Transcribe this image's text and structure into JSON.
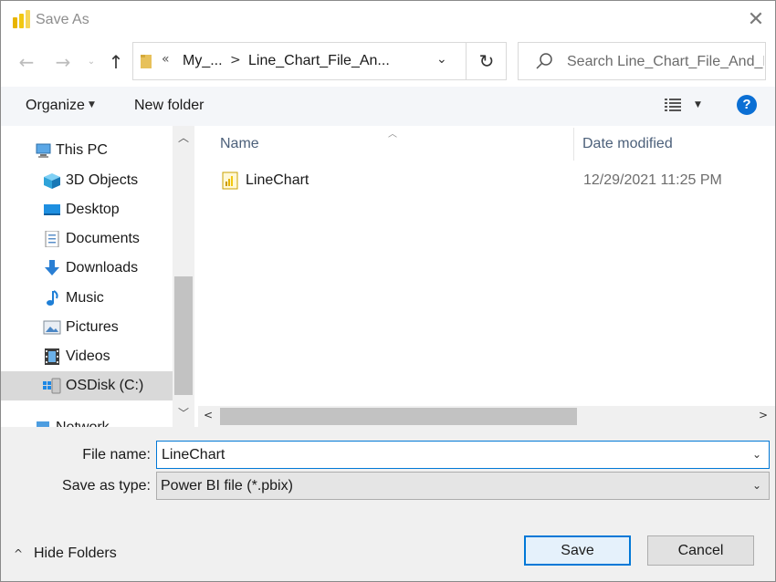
{
  "window": {
    "title": "Save As",
    "close_glyph": "✕"
  },
  "nav": {
    "back_glyph": "←",
    "forward_glyph": "→",
    "recent_glyph": "⌄",
    "up_glyph": "↑"
  },
  "address": {
    "overflow_glyph": "«",
    "segments": [
      "My_...",
      "Line_Chart_File_An..."
    ],
    "separator_glyph": ">",
    "dropdown_glyph": "⌄",
    "refresh_glyph": "↻"
  },
  "search": {
    "placeholder": "Search Line_Chart_File_And_E..."
  },
  "toolbar": {
    "organize_label": "Organize",
    "caret_glyph": "▼",
    "new_folder_label": "New folder",
    "help_label": "?"
  },
  "sidebar": {
    "items": [
      {
        "label": "This PC",
        "icon": "computer-icon"
      },
      {
        "label": "3D Objects",
        "icon": "cube-icon"
      },
      {
        "label": "Desktop",
        "icon": "desktop-icon"
      },
      {
        "label": "Documents",
        "icon": "document-icon"
      },
      {
        "label": "Downloads",
        "icon": "download-arrow-icon"
      },
      {
        "label": "Music",
        "icon": "music-note-icon"
      },
      {
        "label": "Pictures",
        "icon": "picture-icon"
      },
      {
        "label": "Videos",
        "icon": "film-icon"
      },
      {
        "label": "OSDisk (C:)",
        "icon": "drive-icon",
        "selected": true
      },
      {
        "label": "Network",
        "icon": "network-icon"
      }
    ],
    "scroll_up_glyph": "︿",
    "scroll_down_glyph": "﹀"
  },
  "filelist": {
    "columns": {
      "name": "Name",
      "date": "Date modified",
      "sort_glyph": "︿"
    },
    "rows": [
      {
        "name": "LineChart",
        "date": "12/29/2021 11:25 PM",
        "icon": "pbix-file-icon"
      }
    ],
    "scroll_left_glyph": "<",
    "scroll_right_glyph": ">"
  },
  "form": {
    "file_name_label": "File name:",
    "file_name_value": "LineChart",
    "save_type_label": "Save as type:",
    "save_type_value": "Power BI file (*.pbix)",
    "dropdown_glyph": "⌄"
  },
  "footer": {
    "hide_folders_glyph": "^",
    "hide_folders_label": "Hide Folders",
    "save_label": "Save",
    "cancel_label": "Cancel"
  },
  "colors": {
    "accent": "#0078d7",
    "powerbi_yellow": "#f2c811",
    "help_blue": "#0b6fd4",
    "selection": "#d9d9d9"
  }
}
